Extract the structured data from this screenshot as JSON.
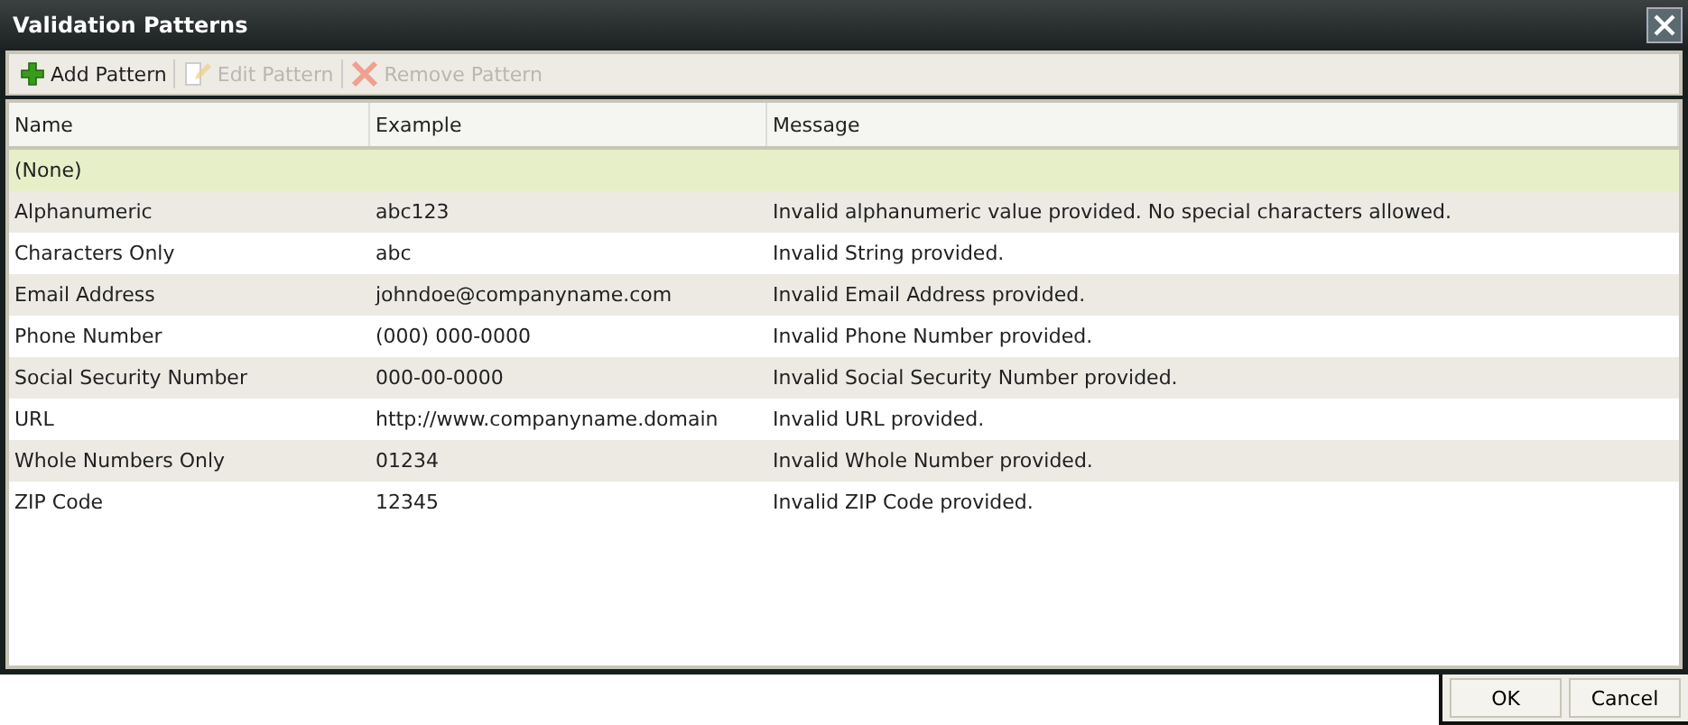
{
  "window": {
    "title": "Validation Patterns"
  },
  "toolbar": [
    {
      "kind": "add",
      "label": "Add Pattern",
      "disabled": false
    },
    {
      "kind": "edit",
      "label": "Edit Pattern",
      "disabled": true
    },
    {
      "kind": "remove",
      "label": "Remove Pattern",
      "disabled": true
    }
  ],
  "table": {
    "columns": [
      "Name",
      "Example",
      "Message"
    ],
    "rows": [
      {
        "cells": [
          "(None)",
          "",
          ""
        ],
        "selected": true
      },
      {
        "cells": [
          "Alphanumeric",
          "abc123",
          "Invalid alphanumeric value provided. No special characters allowed."
        ],
        "selected": false
      },
      {
        "cells": [
          "Characters Only",
          "abc",
          "Invalid String provided."
        ],
        "selected": false
      },
      {
        "cells": [
          "Email Address",
          "johndoe@companyname.com",
          "Invalid Email Address provided."
        ],
        "selected": false
      },
      {
        "cells": [
          "Phone Number",
          "(000) 000-0000",
          "Invalid Phone Number provided."
        ],
        "selected": false
      },
      {
        "cells": [
          "Social Security Number",
          "000-00-0000",
          "Invalid Social Security Number provided."
        ],
        "selected": false
      },
      {
        "cells": [
          "URL",
          "http://www.companyname.domain",
          "Invalid URL provided."
        ],
        "selected": false
      },
      {
        "cells": [
          "Whole Numbers Only",
          "01234",
          "Invalid Whole Number provided."
        ],
        "selected": false
      },
      {
        "cells": [
          "ZIP Code",
          "12345",
          "Invalid ZIP Code provided."
        ],
        "selected": false
      }
    ]
  },
  "buttons": [
    "OK",
    "Cancel"
  ]
}
